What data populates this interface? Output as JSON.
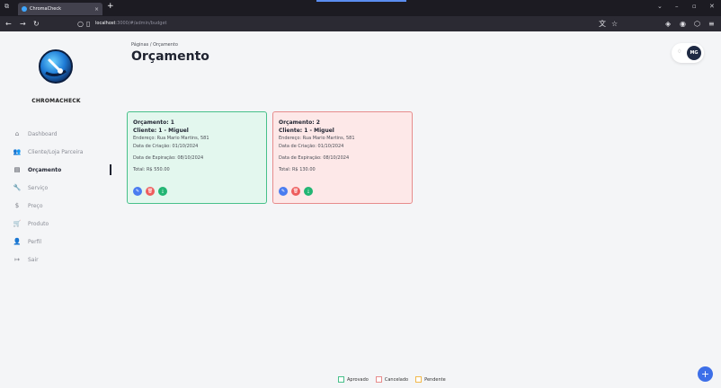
{
  "browser": {
    "tab_title": "ChromaCheck",
    "tab_close": "×",
    "new_tab": "+",
    "url_host": "localhost",
    "url_path": ":3000/#/admin/budget",
    "translate_icon": "translate-icon",
    "bookmark_icon": "star-icon"
  },
  "colors": {
    "approved": "#47c08a",
    "cancelled": "#e78c8c",
    "pending": "#f2b84b",
    "primary": "#3d6fe8"
  },
  "sidebar": {
    "logo_text": "CHROMACHECK",
    "items": [
      {
        "icon": "home-icon",
        "glyph": "⌂",
        "label": "Dashboard"
      },
      {
        "icon": "users-icon",
        "glyph": "👥",
        "label": "Cliente/Loja Parceira"
      },
      {
        "icon": "document-icon",
        "glyph": "▤",
        "label": "Orçamento",
        "active": true
      },
      {
        "icon": "wrench-icon",
        "glyph": "🔧",
        "label": "Serviço"
      },
      {
        "icon": "dollar-icon",
        "glyph": "$",
        "label": "Preço"
      },
      {
        "icon": "cart-icon",
        "glyph": "🛒",
        "label": "Produto"
      },
      {
        "icon": "person-icon",
        "glyph": "👤",
        "label": "Perfil"
      },
      {
        "icon": "logout-icon",
        "glyph": "↦",
        "label": "Sair"
      }
    ]
  },
  "header": {
    "breadcrumb": "Páginas / Orçamento",
    "title": "Orçamento",
    "avatar_initials": "MG"
  },
  "budgets": [
    {
      "status": "approved",
      "title": "Orçamento: 1",
      "client": "Cliente: 1 - Miguel",
      "address": "Endereço: Rua Mario Martins, 581",
      "created": "Data de Criação: 01/10/2024",
      "expires": "Data de Expiração: 08/10/2024",
      "total": "Total: R$ 550.00"
    },
    {
      "status": "cancelled",
      "title": "Orçamento: 2",
      "client": "Cliente: 1 - Miguel",
      "address": "Endereço: Rua Mario Martins, 581",
      "created": "Data de Criação: 01/10/2024",
      "expires": "Data de Expiração: 08/10/2024",
      "total": "Total: R$ 130.00"
    }
  ],
  "legend": {
    "approved": "Aprovado",
    "cancelled": "Cancelado",
    "pending": "Pendente"
  },
  "fab": "+"
}
